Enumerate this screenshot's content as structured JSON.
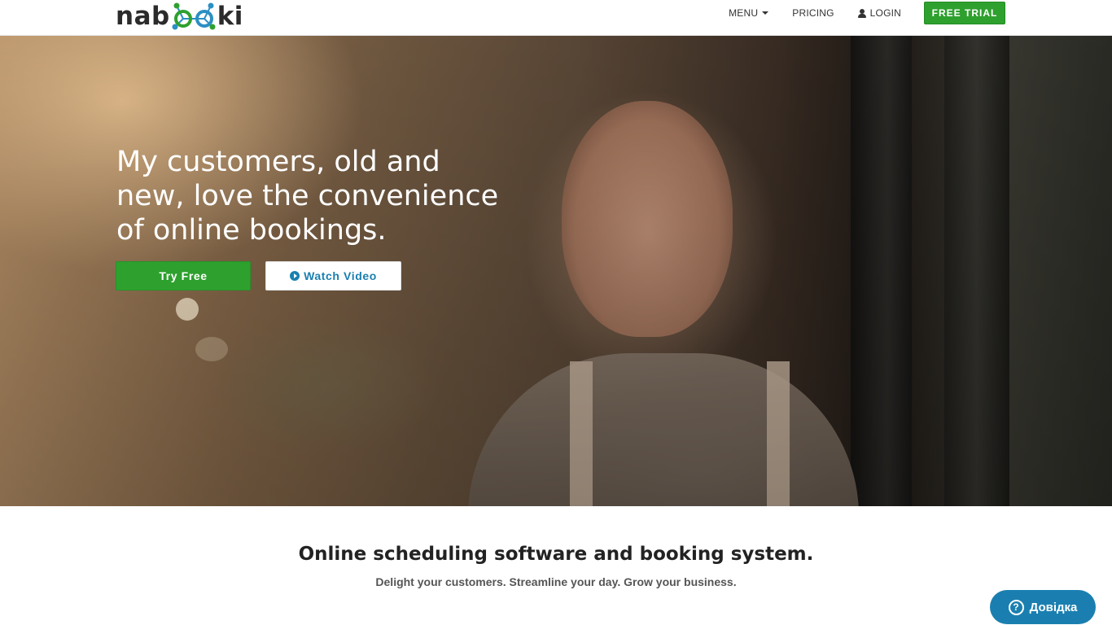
{
  "header": {
    "logo": {
      "part1": "nab",
      "part2": "ki"
    },
    "nav": {
      "menu": "MENU",
      "pricing": "PRICING",
      "login": "LOGIN",
      "free_trial": "FREE TRIAL"
    }
  },
  "hero": {
    "title": "My customers, old and new, love the convenience of online bookings.",
    "try_free": "Try Free",
    "watch_video": "Watch Video"
  },
  "intro": {
    "tagline": "Online scheduling software and booking system.",
    "subline": "Delight your customers. Streamline your day. Grow your business."
  },
  "help_widget": {
    "label": "Довідка",
    "icon_glyph": "?"
  },
  "colors": {
    "brand_green": "#2ea02e",
    "brand_blue": "#1a7fb0"
  },
  "icons": [
    "chevron-down-icon",
    "user-icon",
    "play-icon",
    "question-icon"
  ]
}
